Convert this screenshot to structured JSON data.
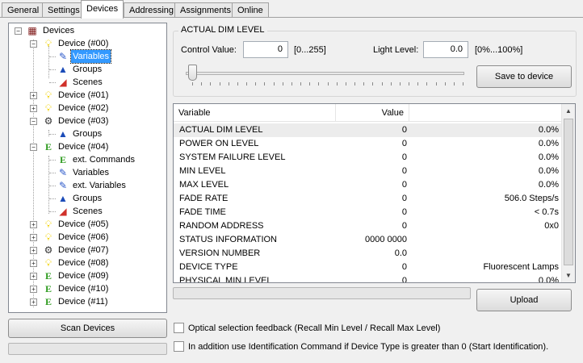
{
  "tabs": [
    "General",
    "Settings",
    "Devices",
    "Addressing",
    "Assignments",
    "Online"
  ],
  "tree": {
    "root": "Devices",
    "items": [
      {
        "label": "Device (#00)",
        "icon": "bulb-icon"
      },
      {
        "label": "Variables",
        "icon": "wand-icon",
        "selected": true
      },
      {
        "label": "Groups",
        "icon": "groups-icon"
      },
      {
        "label": "Scenes",
        "icon": "scenes-icon"
      },
      {
        "label": "Device (#01)",
        "icon": "bulb-icon"
      },
      {
        "label": "Device (#02)",
        "icon": "bulb-icon"
      },
      {
        "label": "Device (#03)",
        "icon": "gear-icon"
      },
      {
        "label": "Groups",
        "icon": "groups-icon"
      },
      {
        "label": "Device (#04)",
        "icon": "e-icon"
      },
      {
        "label": "ext. Commands",
        "icon": "e-icon"
      },
      {
        "label": "Variables",
        "icon": "wand-icon"
      },
      {
        "label": "ext. Variables",
        "icon": "wand-icon"
      },
      {
        "label": "Groups",
        "icon": "groups-icon"
      },
      {
        "label": "Scenes",
        "icon": "scenes-icon"
      },
      {
        "label": "Device (#05)",
        "icon": "bulb-icon"
      },
      {
        "label": "Device (#06)",
        "icon": "bulb-icon"
      },
      {
        "label": "Device (#07)",
        "icon": "gear-icon"
      },
      {
        "label": "Device (#08)",
        "icon": "bulb-icon"
      },
      {
        "label": "Device (#09)",
        "icon": "e-icon"
      },
      {
        "label": "Device (#10)",
        "icon": "e-icon"
      },
      {
        "label": "Device (#11)",
        "icon": "e-icon"
      }
    ]
  },
  "scan_button": "Scan Devices",
  "dim": {
    "legend": "ACTUAL DIM LEVEL",
    "control_label": "Control Value:",
    "control_value": "0",
    "control_range": "[0...255]",
    "light_label": "Light Level:",
    "light_value": "0.0",
    "light_range": "[0%...100%]",
    "slider_value": 0,
    "save_button": "Save to device"
  },
  "grid": {
    "headers": [
      "Variable",
      "Value"
    ],
    "rows": [
      [
        "ACTUAL DIM LEVEL",
        "0",
        "0.0%"
      ],
      [
        "POWER ON LEVEL",
        "0",
        "0.0%"
      ],
      [
        "SYSTEM FAILURE LEVEL",
        "0",
        "0.0%"
      ],
      [
        "MIN LEVEL",
        "0",
        "0.0%"
      ],
      [
        "MAX LEVEL",
        "0",
        "0.0%"
      ],
      [
        "FADE RATE",
        "0",
        "506.0 Steps/s"
      ],
      [
        "FADE TIME",
        "0",
        "< 0.7s"
      ],
      [
        "RANDOM ADDRESS",
        "0",
        "0x0"
      ],
      [
        "STATUS INFORMATION",
        "0000 0000",
        ""
      ],
      [
        "VERSION NUMBER",
        "0.0",
        ""
      ],
      [
        "DEVICE TYPE",
        "0",
        "Fluorescent Lamps"
      ],
      [
        "PHYSICAL MIN LEVEL",
        "0",
        "0.0%"
      ]
    ]
  },
  "upload_button": "Upload",
  "options": [
    "Optical selection feedback (Recall Min Level / Recall Max Level)",
    "In addition use Identification Command if Device Type is greater than 0 (Start Identification)."
  ]
}
